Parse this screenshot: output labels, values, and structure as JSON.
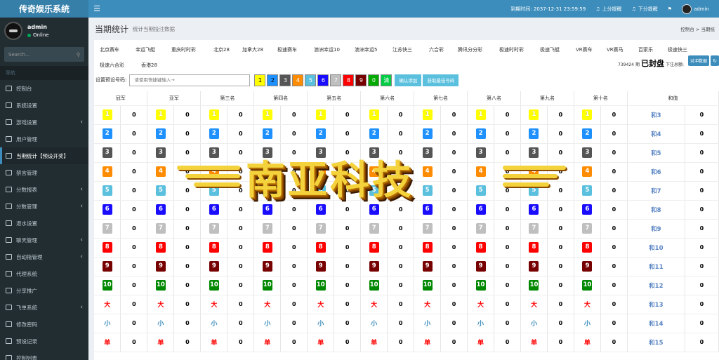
{
  "app": {
    "name": "传奇娱乐系统"
  },
  "topbar": {
    "deadline": "到期时间: 2037-12-31 23:59:59",
    "up_alert": "上分提醒",
    "down_alert": "下分提醒",
    "user": "admin"
  },
  "sidebar": {
    "user": {
      "name": "admin",
      "status": "Online"
    },
    "search_placeholder": "Search...",
    "header": "导航",
    "items": [
      {
        "label": "控制台",
        "chevron": false
      },
      {
        "label": "系统设置",
        "chevron": false
      },
      {
        "label": "游戏设置",
        "chevron": true
      },
      {
        "label": "用户管理",
        "chevron": false
      },
      {
        "label": "当期统计【预设开奖】",
        "chevron": false,
        "active": true
      },
      {
        "label": "禁言管理",
        "chevron": false
      },
      {
        "label": "分数报表",
        "chevron": true
      },
      {
        "label": "分数管理",
        "chevron": true
      },
      {
        "label": "退水设置",
        "chevron": false
      },
      {
        "label": "聊天管理",
        "chevron": true
      },
      {
        "label": "自动拖管理",
        "chevron": true
      },
      {
        "label": "代理系统",
        "chevron": false
      },
      {
        "label": "分享推广",
        "chevron": false
      },
      {
        "label": "飞单系统",
        "chevron": true
      },
      {
        "label": "修改密码",
        "chevron": false
      },
      {
        "label": "预设记录",
        "chevron": false
      },
      {
        "label": "控制列表",
        "chevron": false
      }
    ]
  },
  "page": {
    "title": "当期统计",
    "subtitle": "统计当期投注数据",
    "breadcrumb": "控制台 > 当期统"
  },
  "tabs": [
    "北京赛车",
    "幸运飞艇",
    "重庆时时彩",
    "北京28",
    "加拿大28",
    "极速赛车",
    "澳洲幸运10",
    "澳洲幸运5",
    "江苏快三",
    "六合彩",
    "腾讯分分彩",
    "极速时时彩",
    "极速飞艇",
    "VR赛车",
    "VR赛马",
    "百家乐",
    "极速快三",
    "极速六合彩",
    "香港28"
  ],
  "bet": {
    "amount": "739424",
    "amount_suffix": "期",
    "status": "已封盘",
    "total_label": "下注总额:"
  },
  "buttons": {
    "big_data": "对冲数据",
    "refresh": "↻",
    "confirm": "确认添加",
    "best": "获取最佳号码"
  },
  "preset": {
    "label": "设置预设号码:",
    "placeholder": "请使用快捷键输入→"
  },
  "preset_buttons": [
    {
      "label": "1",
      "color": "#ffff00",
      "text": "#000"
    },
    {
      "label": "2",
      "color": "#1e90ff",
      "text": "#000"
    },
    {
      "label": "3",
      "color": "#555555",
      "text": "#fff"
    },
    {
      "label": "4",
      "color": "#ff8c00",
      "text": "#fff"
    },
    {
      "label": "5",
      "color": "#5bc0de",
      "text": "#fff"
    },
    {
      "label": "6",
      "color": "#1a0dff",
      "text": "#fff"
    },
    {
      "label": "7",
      "color": "#bfbfbf",
      "text": "#fff"
    },
    {
      "label": "8",
      "color": "#ff0000",
      "text": "#fff"
    },
    {
      "label": "9",
      "color": "#770000",
      "text": "#fff"
    },
    {
      "label": "0",
      "color": "#00aa00",
      "text": "#fff"
    },
    {
      "label": "清",
      "color": "#00cc44",
      "text": "#fff"
    }
  ],
  "columns": [
    "冠军",
    "亚军",
    "第三名",
    "第四名",
    "第五名",
    "第六名",
    "第七名",
    "第八名",
    "第九名",
    "第十名"
  ],
  "sum_header": "和值",
  "zero_value": "0",
  "numbers": [
    {
      "label": "1",
      "color": "#ffff00",
      "text": "#ffffff"
    },
    {
      "label": "2",
      "color": "#1e90ff",
      "text": "#ffffff"
    },
    {
      "label": "3",
      "color": "#555555",
      "text": "#ffffff"
    },
    {
      "label": "4",
      "color": "#ff8c00",
      "text": "#ffffff"
    },
    {
      "label": "5",
      "color": "#5bc0de",
      "text": "#ffffff"
    },
    {
      "label": "6",
      "color": "#1a0dff",
      "text": "#ffffff"
    },
    {
      "label": "7",
      "color": "#bfbfbf",
      "text": "#ffffff"
    },
    {
      "label": "8",
      "color": "#ff0000",
      "text": "#ffffff"
    },
    {
      "label": "9",
      "color": "#770000",
      "text": "#ffffff"
    },
    {
      "label": "10",
      "color": "#008800",
      "text": "#ffffff"
    }
  ],
  "words": [
    {
      "label": "大",
      "color": "#ff0000"
    },
    {
      "label": "小",
      "color": "#3c8dbc"
    },
    {
      "label": "单",
      "color": "#ff0000"
    }
  ],
  "sums": [
    "和3",
    "和4",
    "和5",
    "和6",
    "和7",
    "和8",
    "和9",
    "和10",
    "和11",
    "和12",
    "和13",
    "和14",
    "和15"
  ],
  "watermark": "南亚科技"
}
